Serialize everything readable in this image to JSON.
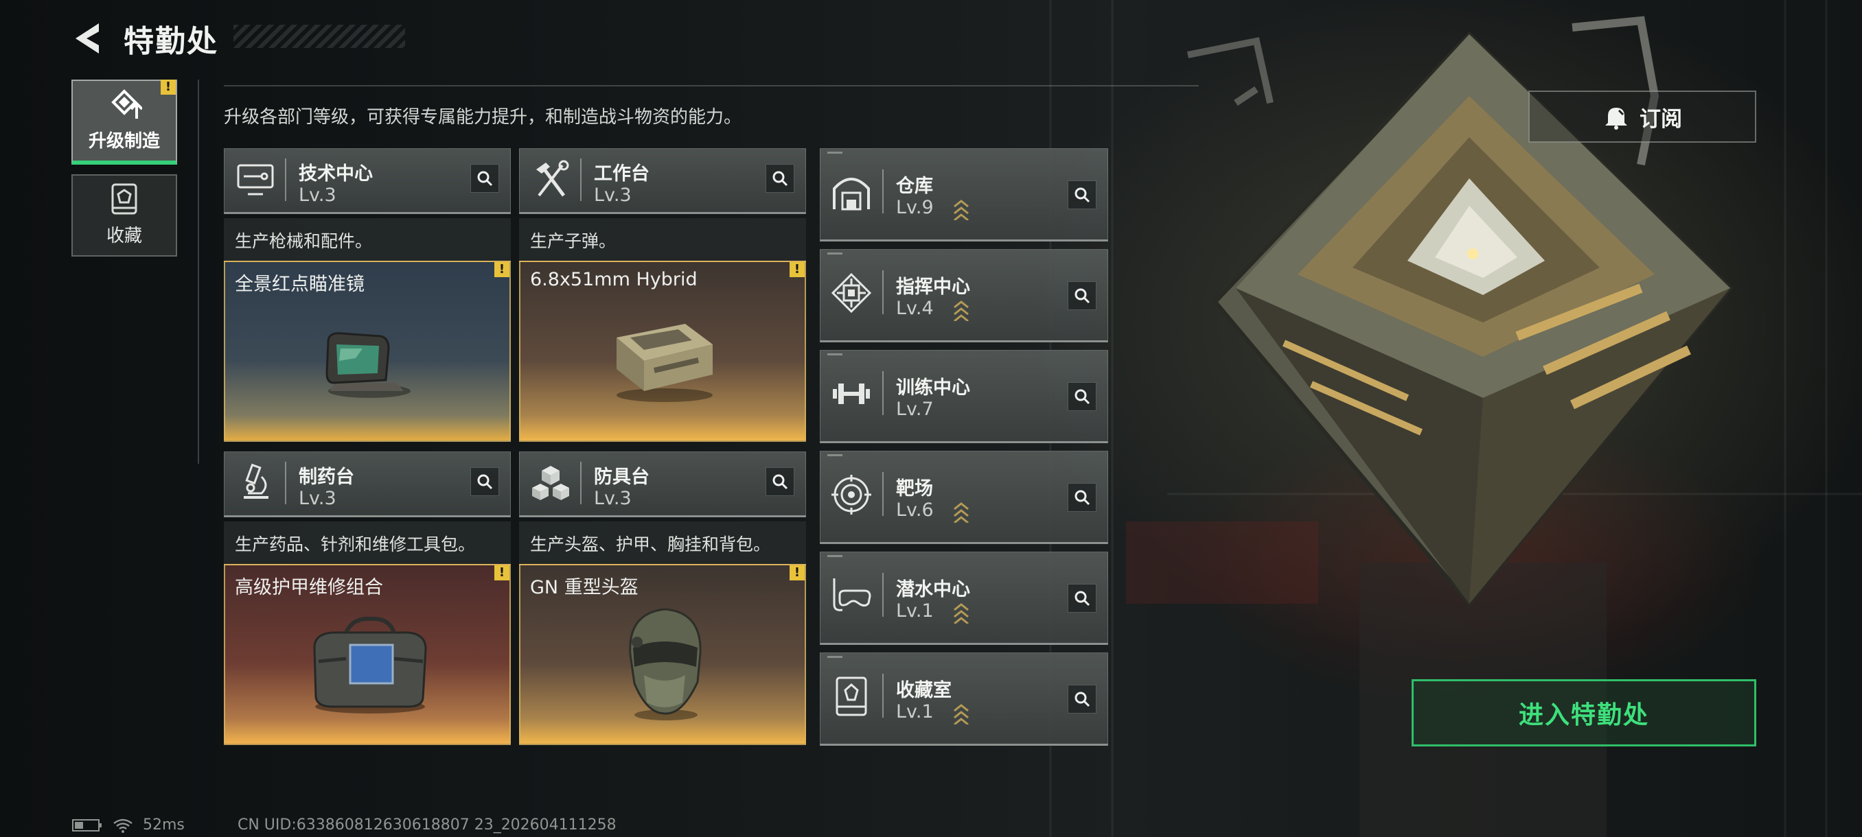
{
  "header": {
    "title": "特勤处"
  },
  "nav": {
    "tabs": [
      {
        "label": "升级制造",
        "active": true,
        "alert": "!"
      },
      {
        "label": "收藏",
        "active": false
      }
    ]
  },
  "description": "升级各部门等级，可获得专属能力提升，和制造战斗物资的能力。",
  "departments": [
    {
      "name": "技术中心",
      "level": "Lv.3",
      "produce": "生产枪械和配件。",
      "item": "全景红点瞄准镜",
      "alert": "!"
    },
    {
      "name": "工作台",
      "level": "Lv.3",
      "produce": "生产子弹。",
      "item": "6.8x51mm Hybrid",
      "alert": "!"
    },
    {
      "name": "制药台",
      "level": "Lv.3",
      "produce": "生产药品、针剂和维修工具包。",
      "item": "高级护甲维修组合",
      "alert": "!"
    },
    {
      "name": "防具台",
      "level": "Lv.3",
      "produce": "生产头盔、护甲、胸挂和背包。",
      "item": "GN 重型头盔",
      "alert": "!"
    }
  ],
  "facilities": [
    {
      "name": "仓库",
      "level": "Lv.9",
      "icon": "warehouse-icon"
    },
    {
      "name": "指挥中心",
      "level": "Lv.4",
      "icon": "command-chip-icon"
    },
    {
      "name": "训练中心",
      "level": "Lv.7",
      "icon": "dumbbell-icon"
    },
    {
      "name": "靶场",
      "level": "Lv.6",
      "icon": "target-icon"
    },
    {
      "name": "潜水中心",
      "level": "Lv.1",
      "icon": "diving-mask-icon"
    },
    {
      "name": "收藏室",
      "level": "Lv.1",
      "icon": "collection-icon"
    }
  ],
  "subscribe_label": "订阅",
  "enter_label": "进入特勤处",
  "status": {
    "ping": "52ms",
    "uid": "CN UID:633860812630618807 23_202604111258"
  },
  "colors": {
    "accent_green": "#35d07a",
    "alert_yellow": "#e8c23a",
    "item_border": "#d7b45f"
  }
}
